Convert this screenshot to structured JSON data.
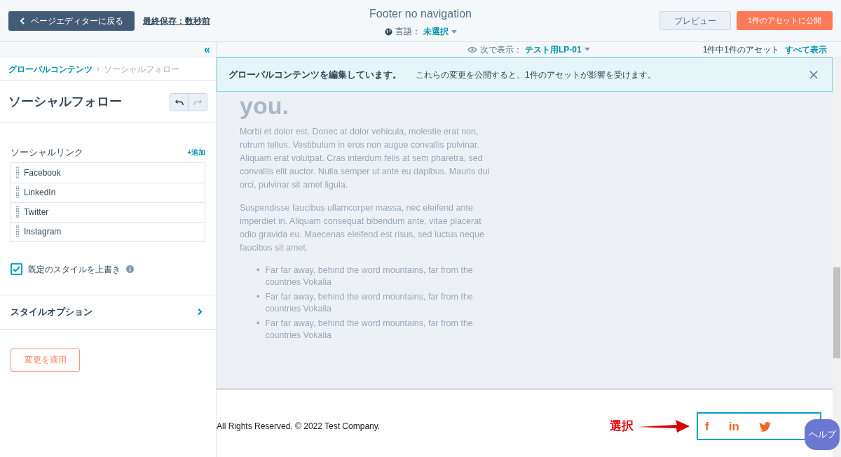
{
  "header": {
    "back_button": "ページエディターに戻る",
    "last_saved": "最終保存：数秒前",
    "title": "Footer no navigation",
    "language_label": "言語：",
    "language_value": "未選択",
    "preview_button": "プレビュー",
    "publish_button": "1件のアセットに公開"
  },
  "subbar": {
    "view_label": "次で表示：",
    "view_value": "テスト用LP-01",
    "asset_count": "1件中1件のアセット",
    "show_all": "すべて表示"
  },
  "sidebar": {
    "collapse": "«",
    "breadcrumb": [
      "グローバルコンテンツ",
      "ソーシャルフォロー"
    ],
    "heading": "ソーシャルフォロー",
    "section_label": "ソーシャルリンク",
    "add_link": "+追加",
    "links": [
      "Facebook",
      "LinkedIn",
      "Twitter",
      "Instagram"
    ],
    "override": {
      "label": "既定のスタイルを上書き",
      "checked": true
    },
    "style_options": "スタイルオプション",
    "apply_button": "変更を適用"
  },
  "banner": {
    "title": "グローバルコンテンツを編集しています。",
    "message": "これらの変更を公開すると、1件のアセットが影響を受けます。"
  },
  "preview": {
    "heading": "you.",
    "paragraphs": [
      "Morbi et dolor est. Donec at dolor vehicula, molestie erat non, rutrum tellus. Vestibulum in eros non augue convallis pulvinar. Aliquam erat volutpat. Cras interdum felis at sem pharetra, sed convallis elit auctor. Nulla semper ut ante eu dapibus. Mauris dui orci, pulvinar sit amet ligula.",
      "Suspendisse faucibus ullamcorper massa, nec eleifend ante imperdiet in. Aliquam consequat bibendum ante, vitae placerat odio gravida eu. Maecenas eleifend est risus, sed luctus neque faucibus sit amet."
    ],
    "bullets": [
      {
        "marker": "•",
        "text": "Far far away, behind the word mountains, far from the countries Vokalia"
      },
      {
        "marker": "•",
        "text": "Far far away, behind the word mountains, far from the countries Vokalia"
      },
      {
        "marker": "•",
        "text": "Far far away, behind the word mountains, far from the countries Vokalia"
      }
    ]
  },
  "footer": {
    "copyright": "All Rights Reserved. © 2022 Test Company.",
    "social_icons": [
      {
        "kind": "text",
        "glyph": "f"
      },
      {
        "kind": "text",
        "glyph": "in"
      },
      {
        "kind": "bird"
      }
    ]
  },
  "annotation": "選択",
  "help_button": "ヘルプ"
}
